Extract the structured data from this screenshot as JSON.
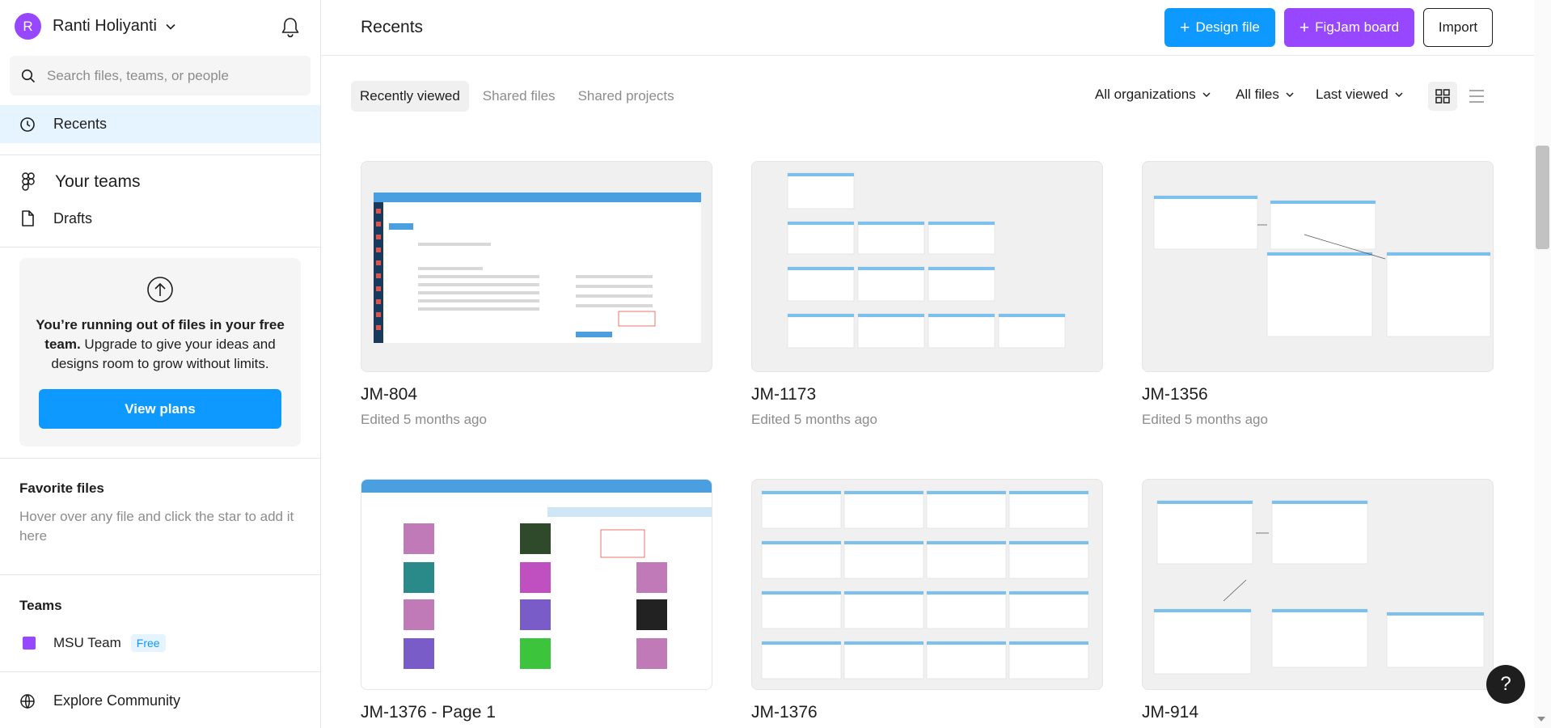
{
  "account": {
    "initial": "R",
    "name": "Ranti Holiyanti"
  },
  "search": {
    "placeholder": "Search files, teams, or people"
  },
  "nav": {
    "recents": "Recents",
    "your_teams": "Your teams",
    "drafts": "Drafts",
    "explore": "Explore Community"
  },
  "upgrade": {
    "bold_text": "You’re running out of files in your free team.",
    "text": " Upgrade to give your ideas and designs room to grow without limits.",
    "button": "View plans"
  },
  "favorites": {
    "title": "Favorite files",
    "hint": "Hover over any file and click the star to add it here"
  },
  "teams": {
    "title": "Teams",
    "items": [
      {
        "name": "MSU Team",
        "badge": "Free"
      }
    ]
  },
  "header": {
    "title": "Recents",
    "design_button": "Design file",
    "figjam_button": "FigJam board",
    "import_button": "Import"
  },
  "tabs": [
    {
      "label": "Recently viewed",
      "active": true
    },
    {
      "label": "Shared files",
      "active": false
    },
    {
      "label": "Shared projects",
      "active": false
    }
  ],
  "filters": {
    "organizations": "All organizations",
    "files": "All files",
    "sort": "Last viewed"
  },
  "files": [
    {
      "name": "JM-804",
      "meta": "Edited 5 months ago"
    },
    {
      "name": "JM-1173",
      "meta": "Edited 5 months ago"
    },
    {
      "name": "JM-1356",
      "meta": "Edited 5 months ago"
    },
    {
      "name": "JM-1376 - Page 1",
      "meta": ""
    },
    {
      "name": "JM-1376",
      "meta": ""
    },
    {
      "name": "JM-914",
      "meta": ""
    }
  ],
  "help": {
    "label": "?"
  },
  "colors": {
    "accent_blue": "#0d99ff",
    "accent_purple": "#9747ff",
    "selected_bg": "#e5f4ff"
  }
}
